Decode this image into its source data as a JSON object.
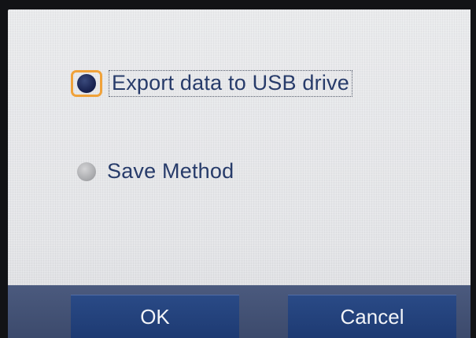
{
  "options": [
    {
      "label": "Export data to USB drive",
      "selected": true
    },
    {
      "label": "Save Method",
      "selected": false
    }
  ],
  "buttons": {
    "ok_label": "OK",
    "cancel_label": "Cancel"
  },
  "colors": {
    "screen_bg": "#e7e8ea",
    "label_text": "#273b6a",
    "selected_radio": "#1a2452",
    "focus_ring": "#f0a23a",
    "button_bg": "#1d3a72",
    "button_text": "#f2f4f8",
    "bottom_bar": "#3c4a6c"
  }
}
